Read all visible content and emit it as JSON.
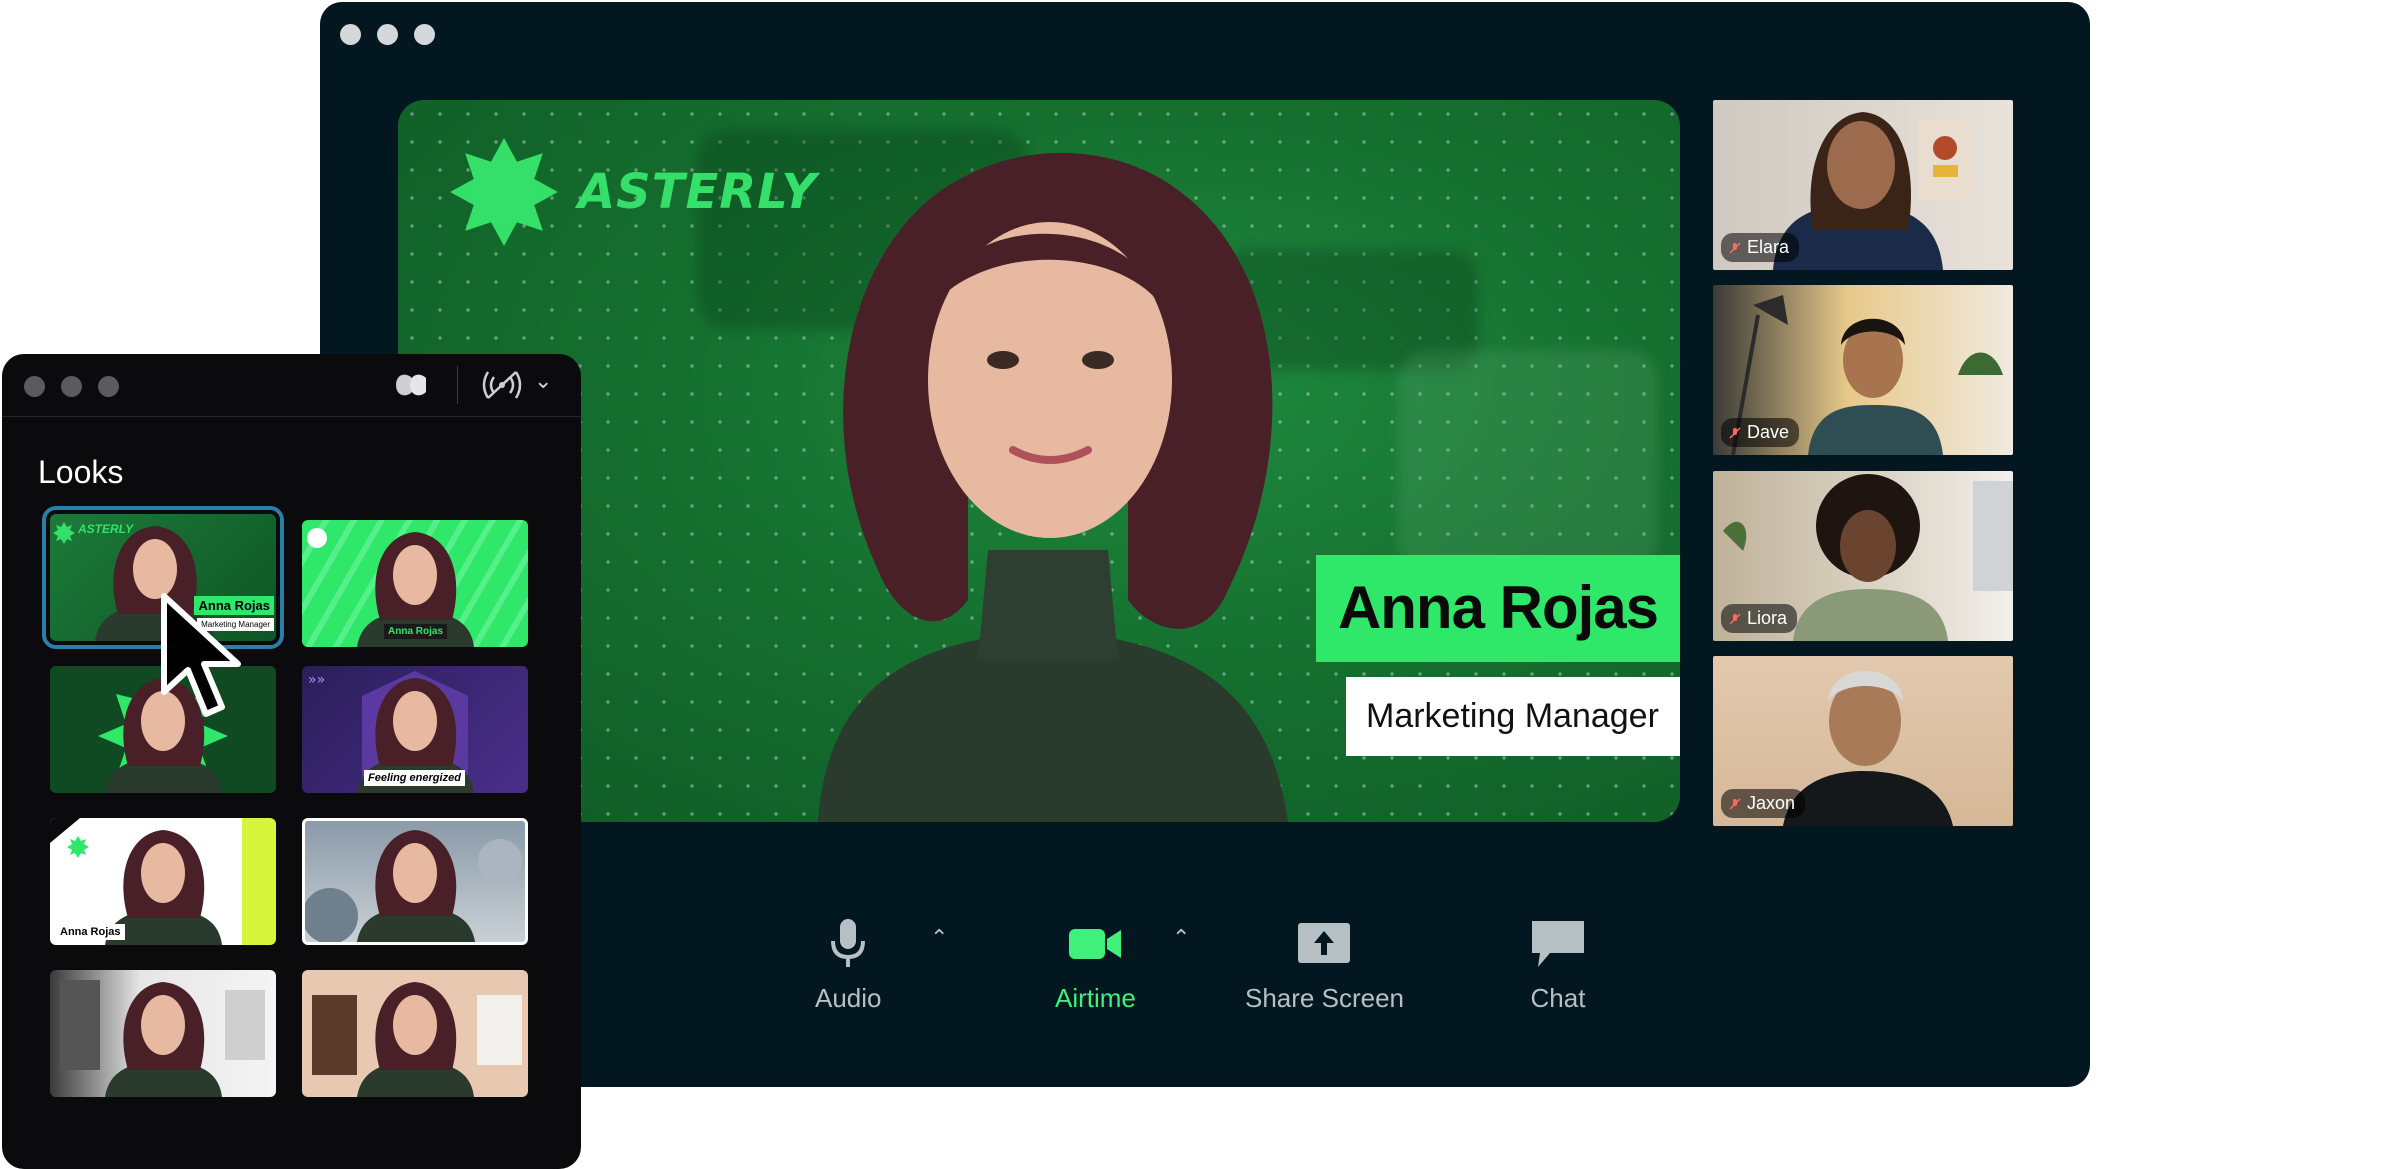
{
  "main_window": {
    "stage": {
      "brand": "ASTERLY",
      "speaker_name": "Anna Rojas",
      "speaker_title": "Marketing Manager"
    },
    "participants": [
      {
        "name": "Elara"
      },
      {
        "name": "Dave"
      },
      {
        "name": "Liora"
      },
      {
        "name": "Jaxon"
      }
    ],
    "controls": {
      "audio": "Audio",
      "airtime": "Airtime",
      "share_screen": "Share Screen",
      "chat": "Chat"
    }
  },
  "looks_window": {
    "title": "Looks",
    "thumbnails": [
      {
        "brand": "ASTERLY",
        "name": "Anna Rojas",
        "title": "Marketing Manager"
      },
      {
        "name": "Anna Rojas"
      },
      {},
      {
        "caption": "Feeling energized"
      },
      {
        "name": "Anna Rojas"
      },
      {},
      {},
      {}
    ]
  },
  "colors": {
    "accent_green": "#2fe86a",
    "window_bg": "#021720",
    "looks_bg": "#0b0b0e",
    "selection": "#2a7fa6"
  }
}
